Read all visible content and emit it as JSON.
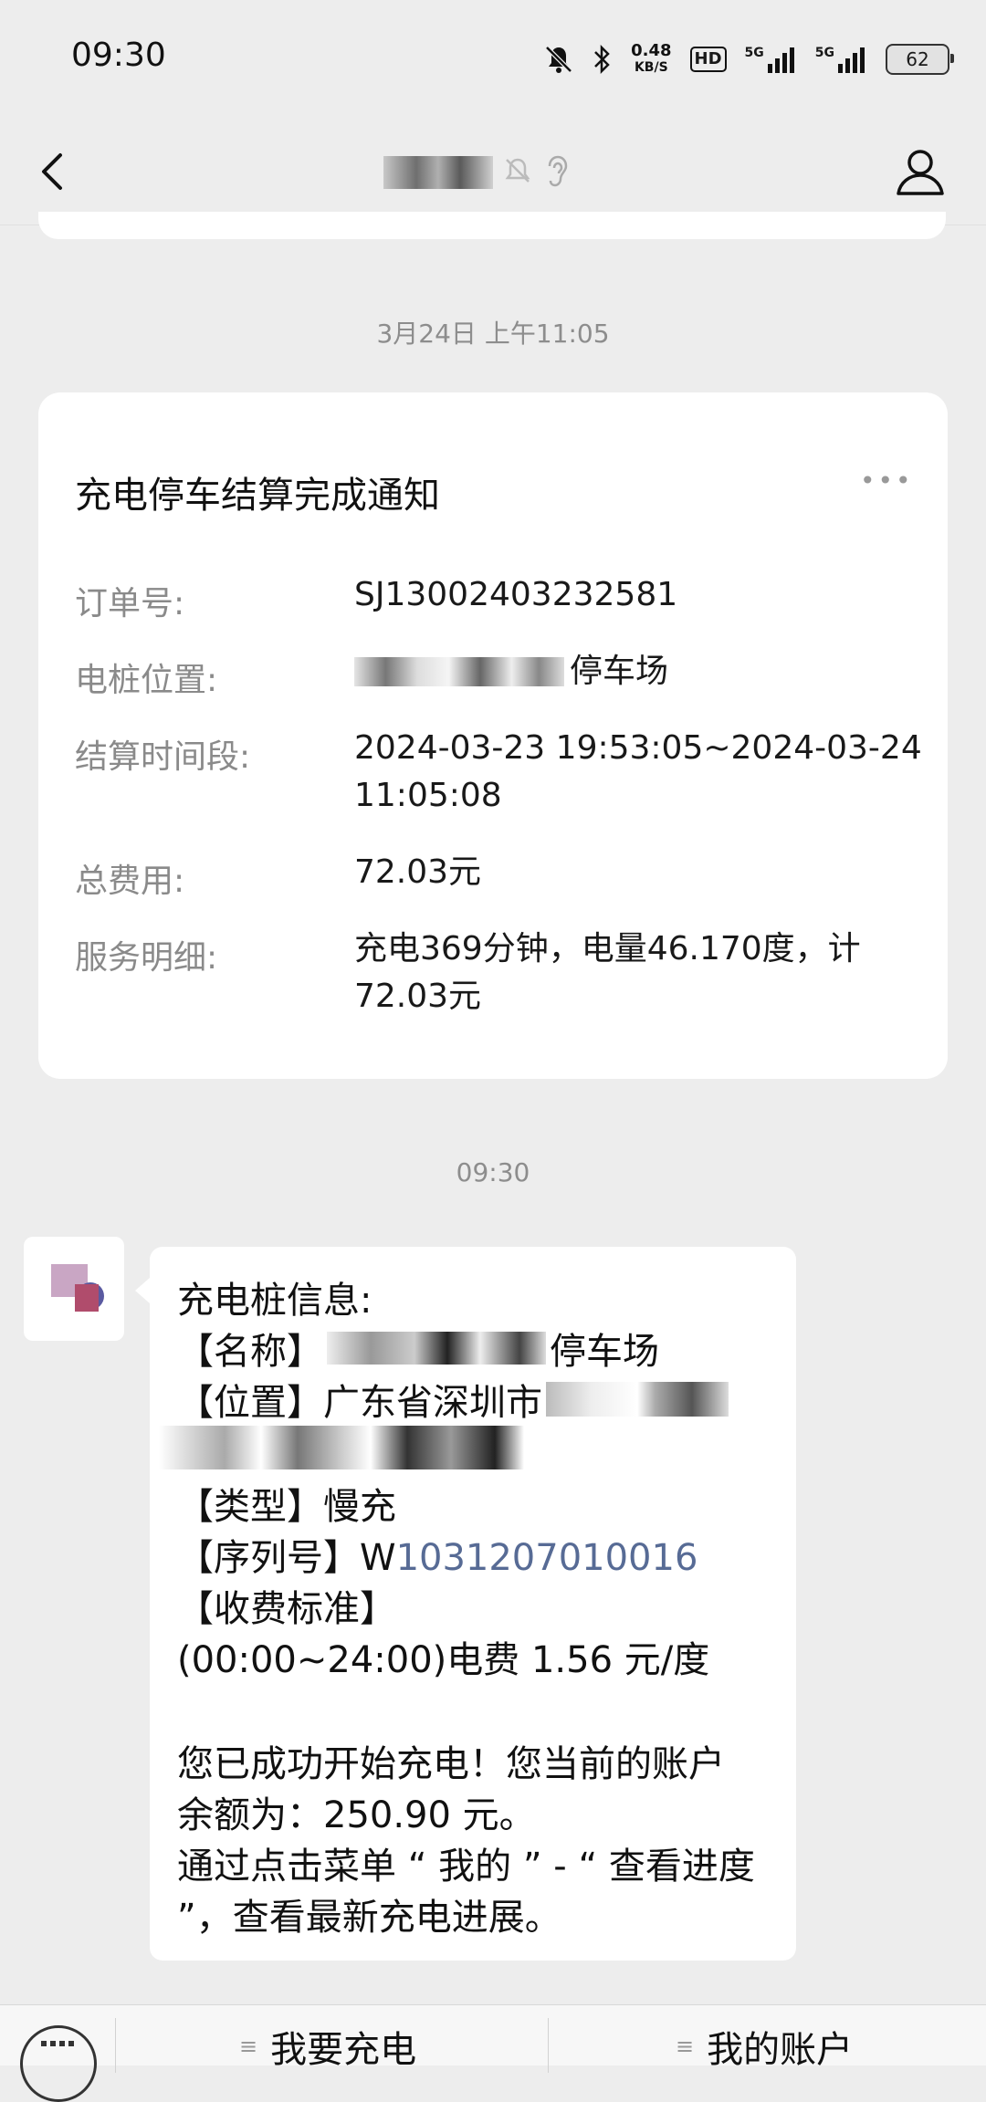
{
  "status_bar": {
    "time": "09:30",
    "speed_value": "0.48",
    "speed_unit": "KB/S",
    "hd_label": "HD",
    "signal1_label": "5G",
    "signal2_label": "5G",
    "battery": "62",
    "icons": [
      "mute-icon",
      "bluetooth-icon",
      "signal-icon",
      "signal-icon",
      "battery-icon"
    ]
  },
  "nav": {
    "back_icon": "chevron-left-icon",
    "profile_icon": "person-icon"
  },
  "timestamps": {
    "first": "3月24日 上午11:05",
    "second": "09:30"
  },
  "card": {
    "title": "充电停车结算完成通知",
    "more": "•••",
    "rows": [
      {
        "label": "订单号:",
        "value": "SJ13002403232581"
      },
      {
        "label": "电桩位置:",
        "value": "停车场"
      },
      {
        "label": "结算时间段:",
        "value": "2024-03-23 19:53:05~2024-03-24\n11:05:08"
      },
      {
        "label": "总费用:",
        "value": "72.03元"
      },
      {
        "label": "服务明细:",
        "value": "充电369分钟，电量46.170度，计\n72.03元"
      }
    ]
  },
  "message": {
    "line1": "充电桩信息:",
    "name_label": "【名称】",
    "name_value": "停车场",
    "location_label": "【位置】",
    "location_value": "广东省深圳市",
    "type_label": "【类型】",
    "type_value": "慢充",
    "serial_label": "【序列号】",
    "serial_prefix": "W",
    "serial_link": "1031207010016",
    "fee_label": "【收费标准】",
    "fee_value": "(00:00~24:00)电费 1.56 元/度",
    "p1": "您已成功开始充电！您当前的账户",
    "p2": "余额为：250.90 元。",
    "p3": "通过点击菜单 “ 我的 ” - “ 查看进度",
    "p4": "”，查看最新充电进展。"
  },
  "bottom_menu": {
    "keyboard_icon": "keyboard-icon",
    "items": [
      {
        "label": "我要充电"
      },
      {
        "label": "我的账户"
      }
    ]
  },
  "colors": {
    "background": "#ededed",
    "link": "#576b95"
  }
}
